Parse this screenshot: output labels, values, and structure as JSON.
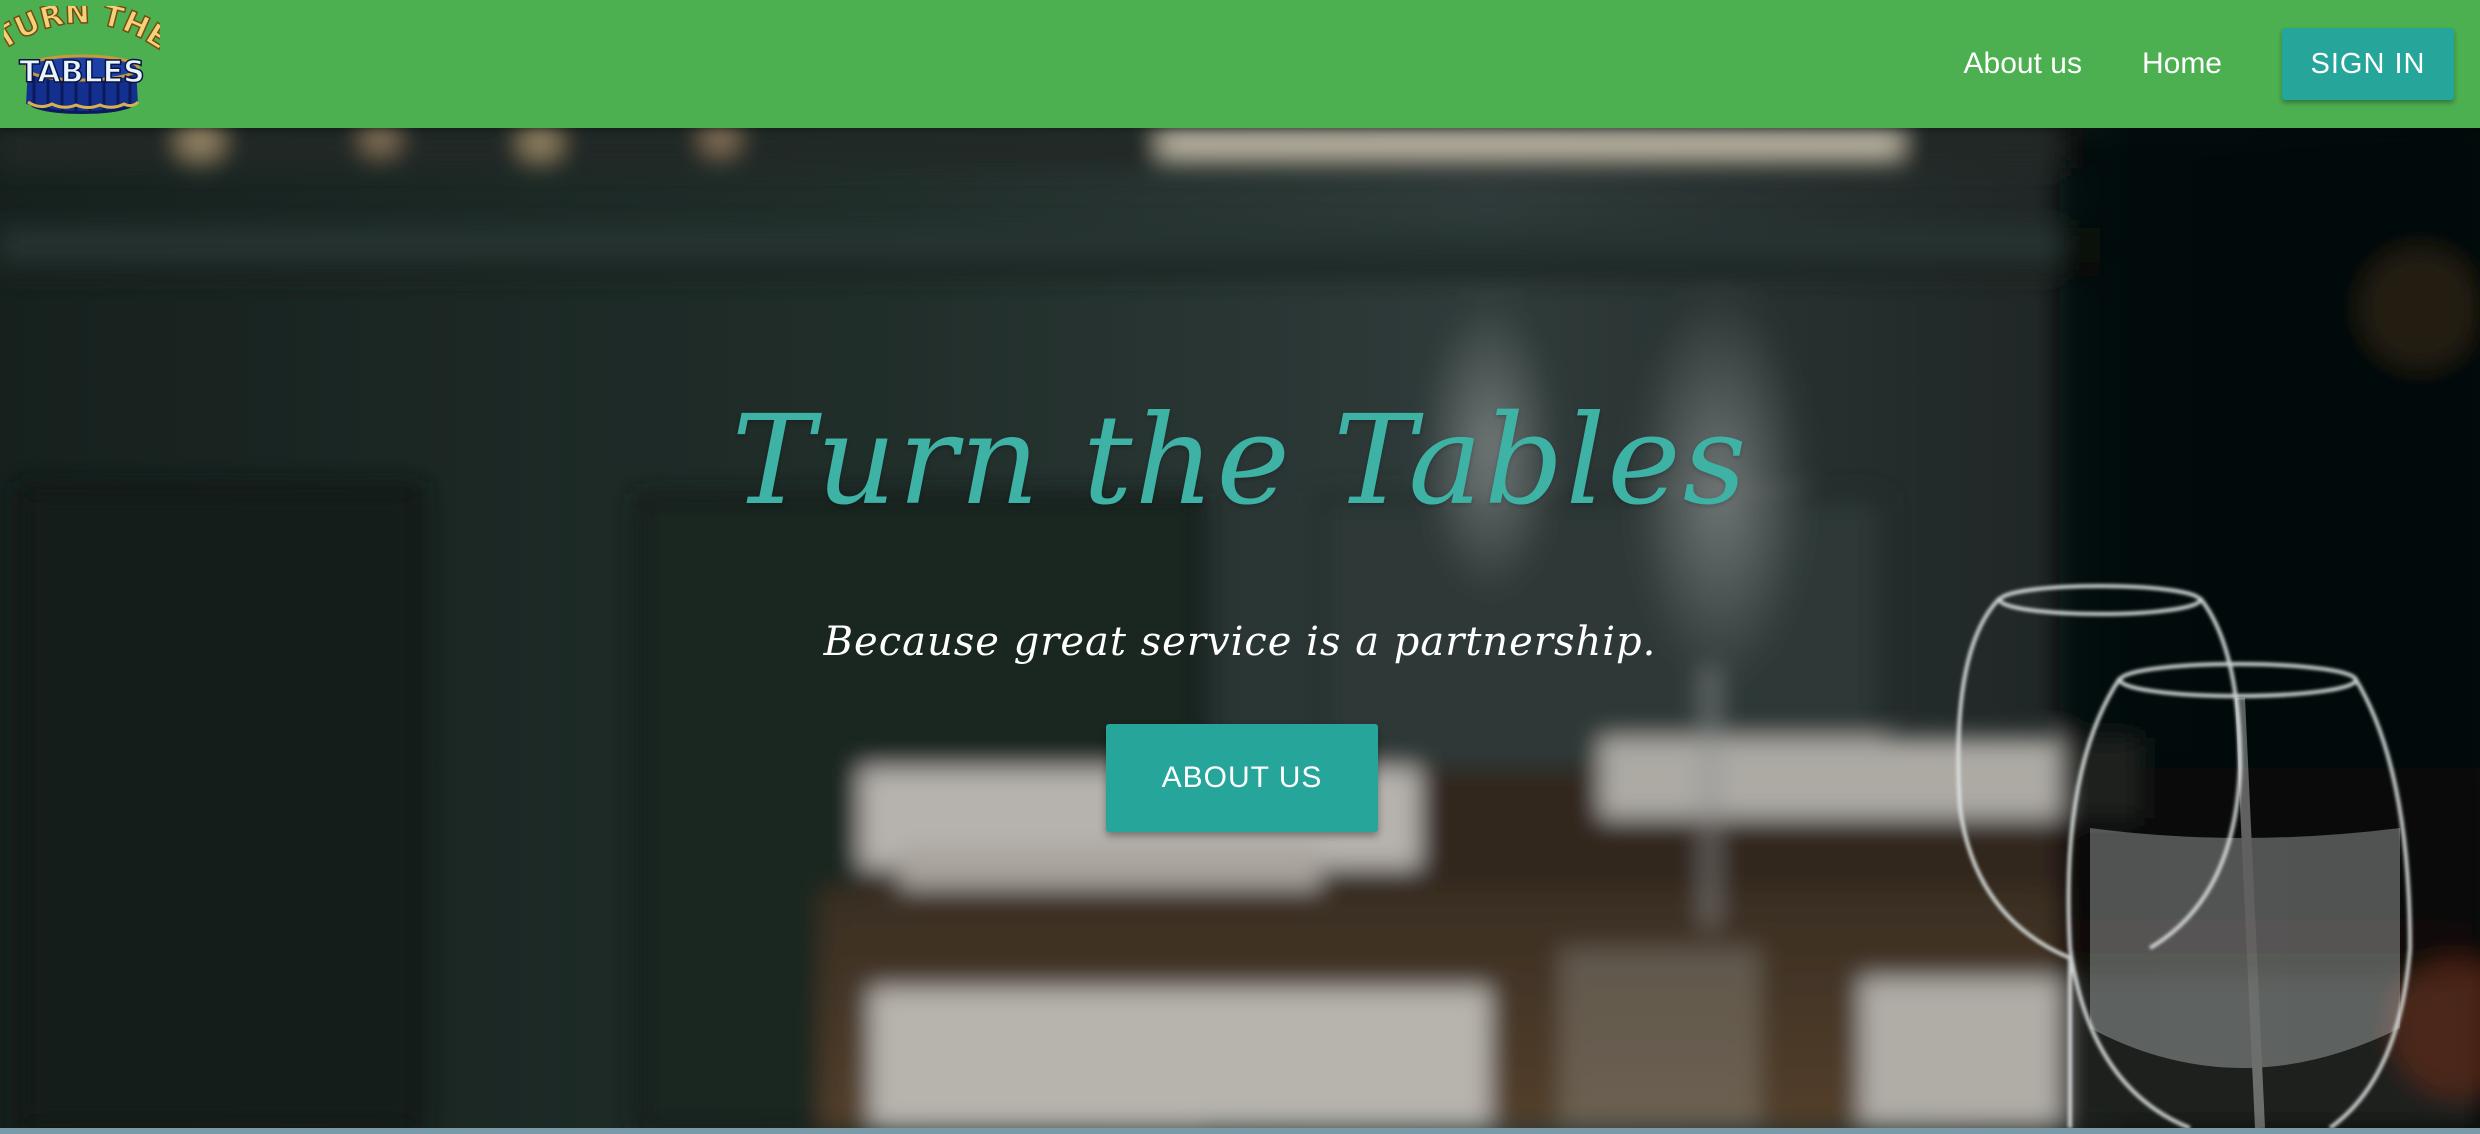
{
  "navbar": {
    "logo": {
      "line1": "TURN THE",
      "line2": "TABLES"
    },
    "links": {
      "about": "About us",
      "home": "Home"
    },
    "signin_label": "SIGN IN"
  },
  "hero": {
    "title": "Turn the Tables",
    "subtitle": "Because great service is a partnership.",
    "cta_label": "ABOUT US"
  },
  "colors": {
    "navbar": "#4caf50",
    "accent": "#26a69a",
    "title": "#3fb2a6"
  }
}
